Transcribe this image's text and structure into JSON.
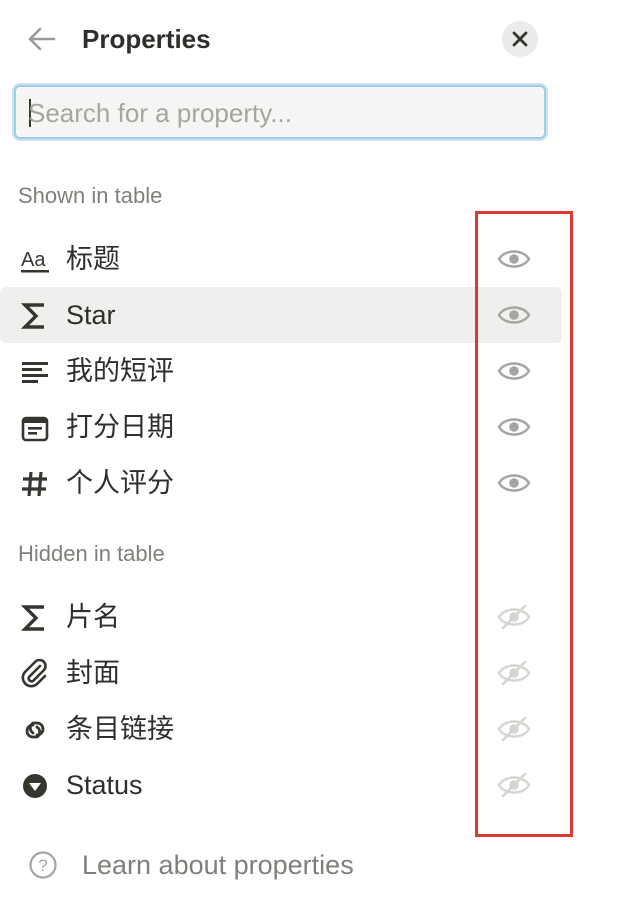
{
  "header": {
    "title": "Properties"
  },
  "search": {
    "placeholder": "Search for a property..."
  },
  "sections": {
    "shown_label": "Shown in table",
    "hidden_label": "Hidden in table"
  },
  "shown": [
    {
      "label": "标题",
      "icon": "text-icon",
      "visible": true
    },
    {
      "label": "Star",
      "icon": "sigma-icon",
      "visible": true
    },
    {
      "label": "我的短评",
      "icon": "lines-icon",
      "visible": true
    },
    {
      "label": "打分日期",
      "icon": "calendar-icon",
      "visible": true
    },
    {
      "label": "个人评分",
      "icon": "hash-icon",
      "visible": true
    }
  ],
  "hidden": [
    {
      "label": "片名",
      "icon": "sigma-icon",
      "visible": false
    },
    {
      "label": "封面",
      "icon": "paperclip-icon",
      "visible": false
    },
    {
      "label": "条目链接",
      "icon": "link-icon",
      "visible": false
    },
    {
      "label": "Status",
      "icon": "status-icon",
      "visible": false
    }
  ],
  "footer": {
    "learn_label": "Learn about properties"
  },
  "colors": {
    "highlight": "#dc3b34",
    "focus_ring": "#9fcde8",
    "hover_row": "#efefee"
  }
}
